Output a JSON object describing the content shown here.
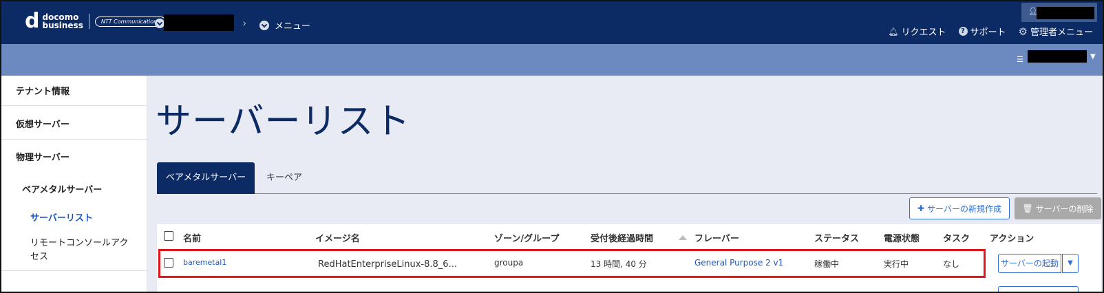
{
  "header": {
    "logo_mark": "d",
    "logo_line1": "docomo",
    "logo_line2": "business",
    "logo_ntt": "NTT Communications",
    "menu_label": "メニュー",
    "links": [
      {
        "icon": "bell-icon",
        "label": "リクエスト"
      },
      {
        "icon": "question-icon",
        "label": "サポート"
      },
      {
        "icon": "gear-icon",
        "label": "管理者メニュー"
      }
    ]
  },
  "sidebar": {
    "items": [
      {
        "label": "テナント情報"
      },
      {
        "label": "仮想サーバー"
      },
      {
        "label": "物理サーバー"
      },
      {
        "label": "ベアメタルサーバー"
      },
      {
        "label": "サーバーリスト"
      },
      {
        "label": "リモートコンソールアクセス"
      }
    ]
  },
  "main": {
    "title": "サーバーリスト",
    "tabs": [
      {
        "label": "ベアメタルサーバー",
        "active": true
      },
      {
        "label": "キーペア",
        "active": false
      }
    ],
    "create_button": "サーバーの新規作成",
    "delete_button": "サーバーの削除",
    "table": {
      "columns": [
        "名前",
        "イメージ名",
        "ゾーン/グループ",
        "受付後経過時間",
        "フレーバー",
        "ステータス",
        "電源状態",
        "タスク",
        "アクション"
      ],
      "rows": [
        {
          "name": "baremetal1",
          "image": "RedHatEnterpriseLinux-8.8_6...",
          "zone": "groupa",
          "elapsed": "13 時間, 40 分",
          "flavor": "General Purpose 2 v1",
          "status": "稼働中",
          "power": "実行中",
          "task": "なし",
          "action": "サーバーの起動"
        }
      ]
    }
  },
  "colors": {
    "header_bg": "#0c2a63",
    "subbar_bg": "#6d8ac0",
    "main_bg": "#e8ebf3",
    "link": "#1a56c2",
    "highlight": "#e3151c"
  }
}
